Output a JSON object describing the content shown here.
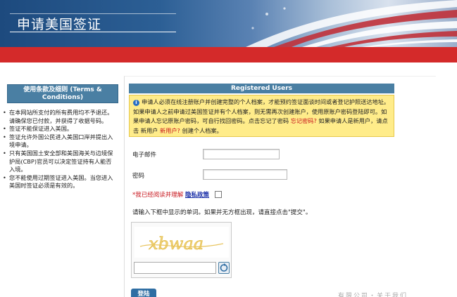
{
  "header": {
    "title": "申请美国签证"
  },
  "sidebar": {
    "box_title": "使用条款及细则 (Terms & Conditions)",
    "items": [
      "在本网站所支付的所有费用均不予退还。请确保您已付款，并获得了收据号码。",
      "签证不能保证进入美国。",
      "签证允许外国公民进入美国口岸并提出入境申请。",
      "只有美国国土安全部和美国海关与边境保护局(CBP)官员可以决定签证持有人能否入境。",
      "您不能使用过期签证进入美国。当您进入美国时签证必须是有效的。"
    ]
  },
  "main": {
    "panel_title": "Registered Users",
    "notice": {
      "text1": "申请人必须在线注册账户并创建完整的个人档案，才能预约签证面谈时间或者登记护照送达地址。 如果申请人之前申请过美国签证并有个人档案，则无需再次创建账户，使用原账户密码登陆即可。如果申请人忘记原账户密码，可自行找回密码。点击忘记了密码",
      "forgot_link": "忘记密码?",
      "text2": "如果申请人是新用户，请点击 新用户",
      "new_user_link": "新用户?",
      "text3": "创建个人档案。"
    },
    "email_label": "电子邮件",
    "password_label": "密码",
    "agree": {
      "star": "*",
      "text": "我已经阅读并理解",
      "link": "隐私政策"
    },
    "hint": "请输入下框中显示的单词。如果并无方框出现，请直接点击\"提交\"。",
    "captcha_text": "xbwaa",
    "login_label": "登陆",
    "faded_text": "有限公司・关于我们"
  }
}
